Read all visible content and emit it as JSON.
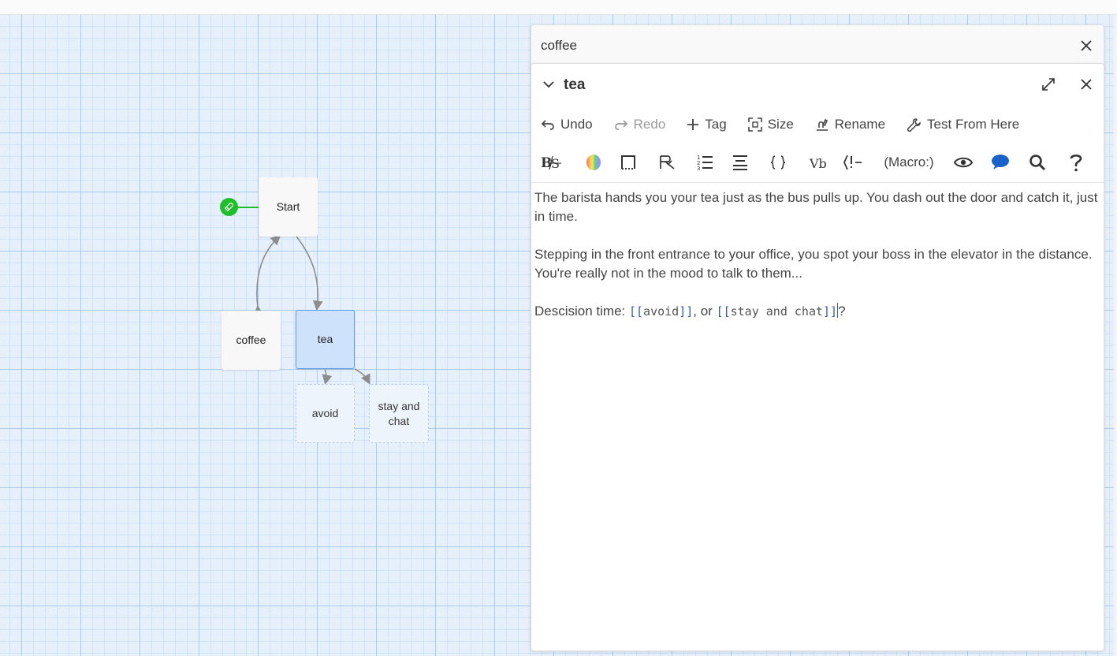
{
  "map": {
    "passages": [
      {
        "name": "Start"
      },
      {
        "name": "coffee"
      },
      {
        "name": "tea"
      },
      {
        "name": "avoid"
      },
      {
        "name": "stay and chat"
      }
    ]
  },
  "dialogs": {
    "collapsed": {
      "title": "coffee"
    },
    "main": {
      "title": "tea",
      "toolbar": {
        "undo": "Undo",
        "redo": "Redo",
        "tag": "Tag",
        "size": "Size",
        "rename": "Rename",
        "test": "Test From Here"
      },
      "format_toolbar": {
        "macro_label": "(Macro:)"
      },
      "text": {
        "para1": "The barista hands you your tea just as the bus pulls up. You dash out the door and catch it, just in time.",
        "para2": "Stepping in the front entrance to your office, you spot your boss in the elevator in the distance. You're really not in the mood to talk to them...",
        "para3_prefix": "Descision time: ",
        "link1": "avoid",
        "mid": ", or ",
        "link2": "stay and chat",
        "suffix": "?"
      }
    }
  },
  "colors": {
    "grid_background": "#e6f0fb",
    "start_badge": "#1fbf2a",
    "selected_passage": "#cfe2fb",
    "link_bracket": "#3a55c6",
    "comment_icon": "#1a62c9"
  }
}
